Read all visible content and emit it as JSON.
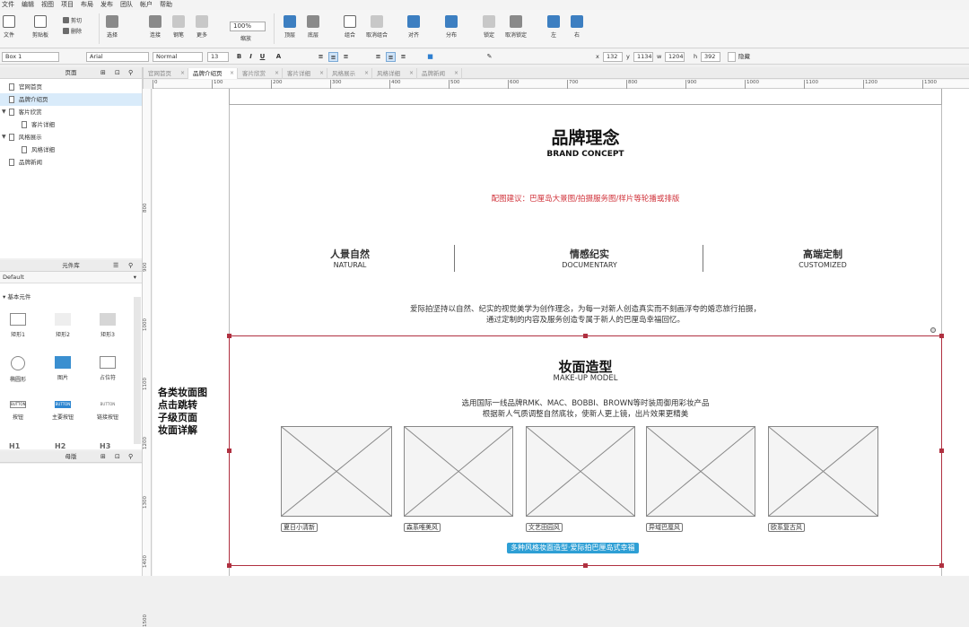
{
  "menu": [
    "文件",
    "编辑",
    "视图",
    "项目",
    "布局",
    "发布",
    "团队",
    "帐户",
    "帮助"
  ],
  "ribbon": {
    "file": "文件",
    "clipboard": "剪贴板",
    "cut": "剪切",
    "delete": "删除",
    "select": "选择",
    "connect": "连接",
    "pen": "钢笔",
    "more": "更多",
    "zoom_value": "100%",
    "zoom_label": "缩放",
    "top": "顶层",
    "bottom": "底层",
    "group": "组合",
    "ungroup": "取消组合",
    "align": "对齐",
    "distribute": "分布",
    "lock": "锁定",
    "unlock": "取消锁定",
    "left": "左",
    "right": "右"
  },
  "format": {
    "element": "Box 1",
    "font": "Arial",
    "style": "Normal",
    "size": "13",
    "x_label": "x",
    "x": "132",
    "y_label": "y",
    "y": "1134",
    "w_label": "w",
    "w": "1204",
    "h_label": "h",
    "h": "392",
    "hidden_label": "隐藏"
  },
  "pages_panel": {
    "title": "页面",
    "items": [
      {
        "label": "官网首页",
        "level": 0,
        "expand": ""
      },
      {
        "label": "品牌介绍页",
        "level": 0,
        "expand": "",
        "selected": true
      },
      {
        "label": "客片欣赏",
        "level": 0,
        "expand": "▼"
      },
      {
        "label": "客片详细",
        "level": 1,
        "expand": ""
      },
      {
        "label": "风格展示",
        "level": 0,
        "expand": "▼"
      },
      {
        "label": "风格详细",
        "level": 1,
        "expand": ""
      },
      {
        "label": "品牌新闻",
        "level": 0,
        "expand": ""
      }
    ]
  },
  "library_panel": {
    "title": "元件库",
    "library": "Default",
    "category": "基本元件",
    "widgets": [
      "矩形1",
      "矩形2",
      "矩形3",
      "椭圆形",
      "图片",
      "占位符",
      "按钮",
      "主要按钮",
      "链接按钮"
    ],
    "headings": [
      "H1",
      "H2",
      "H3"
    ],
    "button_text": "BUTTON"
  },
  "masters_panel": {
    "title": "母版"
  },
  "tabs": [
    {
      "label": "官网首页",
      "active": false
    },
    {
      "label": "品牌介绍页",
      "active": true
    },
    {
      "label": "客片欣赏",
      "active": false
    },
    {
      "label": "客片详细",
      "active": false
    },
    {
      "label": "风格展示",
      "active": false
    },
    {
      "label": "风格详细",
      "active": false
    },
    {
      "label": "品牌新闻",
      "active": false
    }
  ],
  "ruler_h": [
    "0",
    "100",
    "200",
    "300",
    "400",
    "500",
    "600",
    "700",
    "800",
    "900",
    "1000",
    "1100",
    "1200",
    "1300"
  ],
  "ruler_v": [
    "800",
    "900",
    "1000",
    "1100",
    "1200",
    "1300",
    "1400",
    "1500"
  ],
  "canvas": {
    "brand_title": "品牌理念",
    "brand_sub": "BRAND CONCEPT",
    "annotation": "配图建议：巴厘岛大景图/拍摄服务图/样片等轮播或排版",
    "features": [
      {
        "title": "人景自然",
        "sub": "NATURAL"
      },
      {
        "title": "情感纪实",
        "sub": "DOCUMENTARY"
      },
      {
        "title": "高端定制",
        "sub": "CUSTOMIZED"
      }
    ],
    "para1": "爱际拍坚持以自然、纪实的视觉美学为创作理念，为每一对新人创造真实而不刻画浮夸的婚恋旅行拍摄，",
    "para2": "通过定制的内容及服务创造专属于新人的巴厘岛幸福回忆。",
    "makeup_title": "妆面造型",
    "makeup_sub": "MAKE-UP MODEL",
    "makeup_p1": "选用国际一线品牌RMK、MAC、BOBBI、BROWN等时装周御用彩妆产品",
    "makeup_p2": "根据新人气质调整自然底妆，使新人更上镜，出片效果更精美",
    "styles": [
      "夏日小清新",
      "森系唯美风",
      "文艺田园风",
      "异域巴厘风",
      "欧系复古风"
    ],
    "banner": "多种风格妆面造型·爱际拍巴厘岛式幸福",
    "side_note": [
      "各类妆面图",
      "点击跳转",
      "子级页面",
      "妆面详解"
    ]
  },
  "colors": {
    "accent_red": "#b03040",
    "annotation_red": "#d0333b",
    "banner_blue": "#2e9fd5",
    "selection_blue": "#d9ebfa"
  }
}
